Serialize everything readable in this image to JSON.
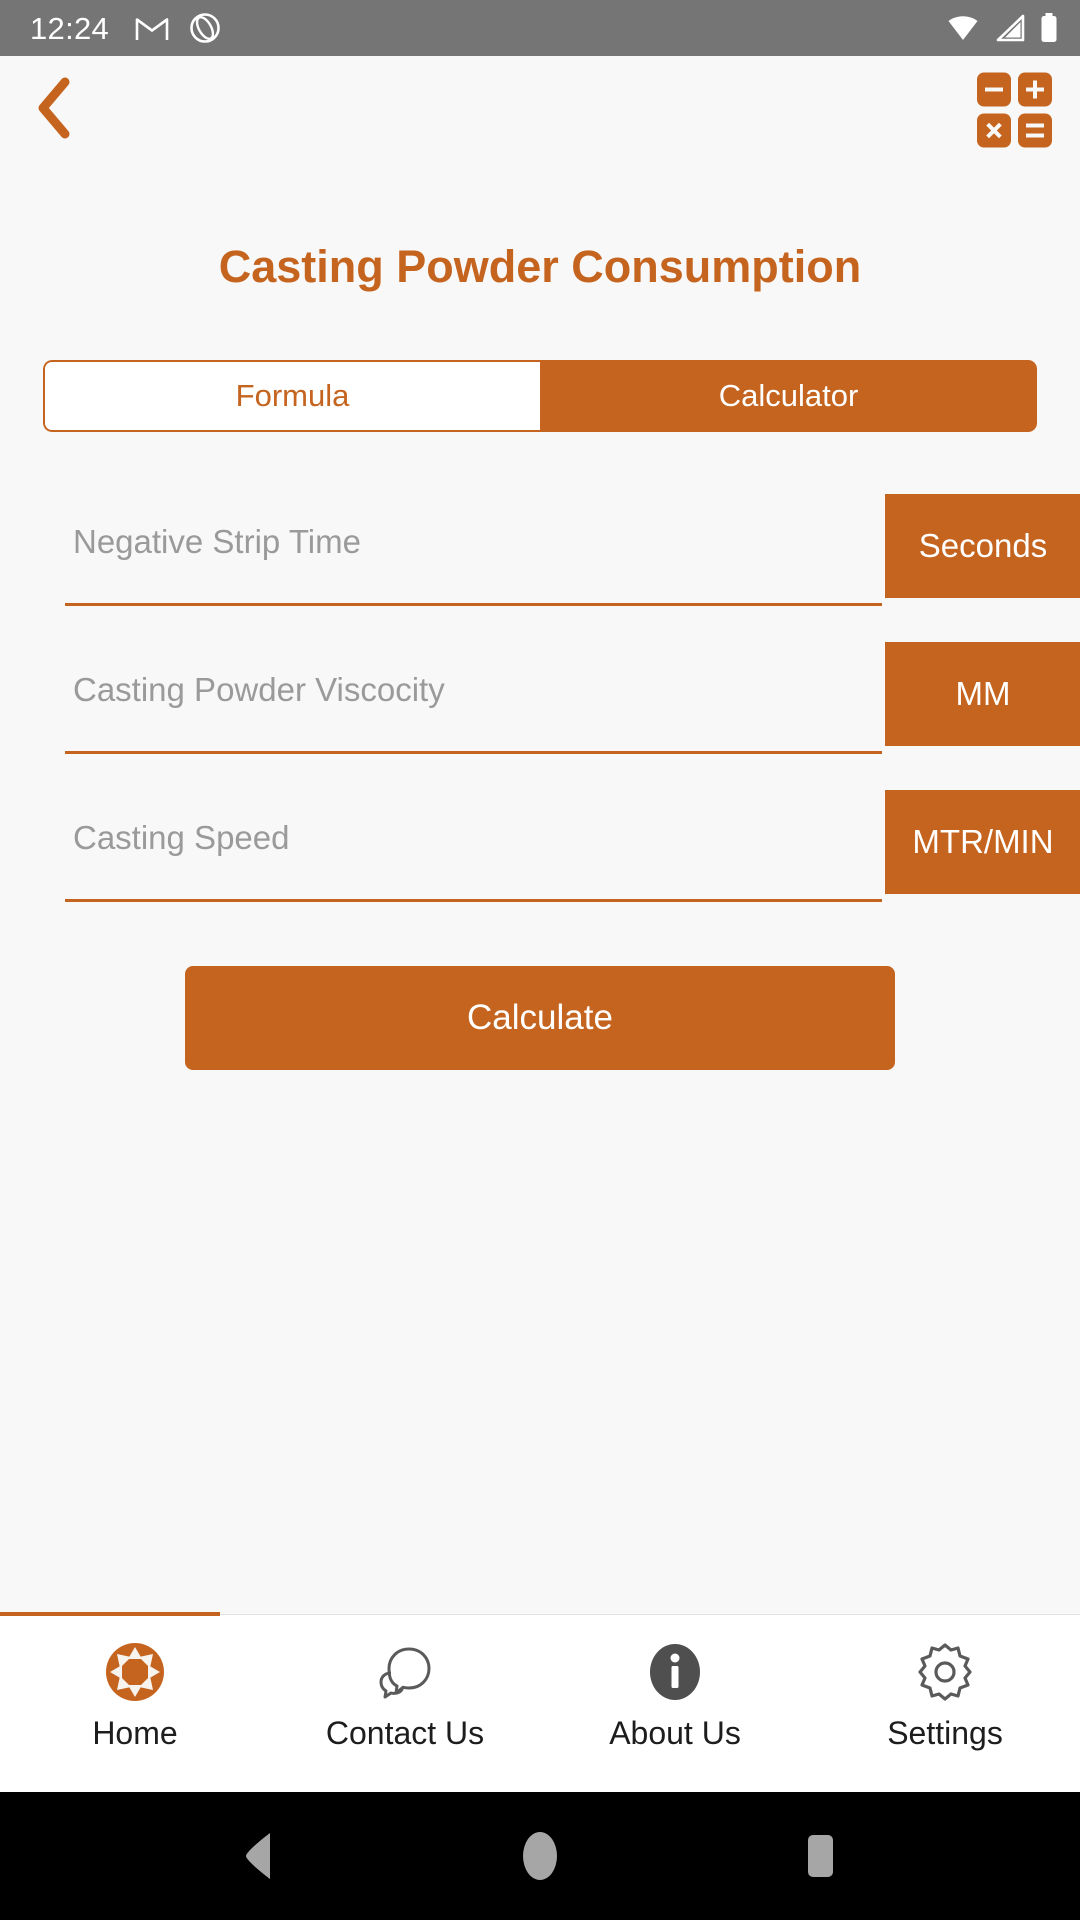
{
  "status_bar": {
    "time": "12:24",
    "left_icons": [
      "gmail-icon",
      "camera-aperture-icon"
    ],
    "right_icons": [
      "wifi-icon",
      "cellular-signal-icon",
      "battery-icon"
    ],
    "background_color": "#757575"
  },
  "app_bar": {
    "back_label": "Back",
    "calculator_icon_keys": [
      "minus",
      "plus",
      "multiply",
      "equals"
    ],
    "accent_color": "#c5641f"
  },
  "main": {
    "title": "Casting Powder Consumption",
    "tabs": [
      {
        "label": "Formula",
        "active": false
      },
      {
        "label": "Calculator",
        "active": true
      }
    ],
    "fields": [
      {
        "placeholder": "Negative Strip Time",
        "value": "",
        "unit": "Seconds"
      },
      {
        "placeholder": "Casting Powder Viscocity",
        "value": "",
        "unit": "MM"
      },
      {
        "placeholder": "Casting Speed",
        "value": "",
        "unit": "MTR/MIN"
      }
    ],
    "calculate_label": "Calculate"
  },
  "bottom_nav": {
    "items": [
      {
        "label": "Home",
        "icon": "aperture-icon",
        "active": true
      },
      {
        "label": "Contact Us",
        "icon": "chat-bubble-icon",
        "active": false
      },
      {
        "label": "About Us",
        "icon": "info-circle-icon",
        "active": false
      },
      {
        "label": "Settings",
        "icon": "gear-icon",
        "active": false
      }
    ]
  },
  "android_nav": {
    "buttons": [
      "back-triangle",
      "home-circle",
      "recents-square"
    ]
  }
}
